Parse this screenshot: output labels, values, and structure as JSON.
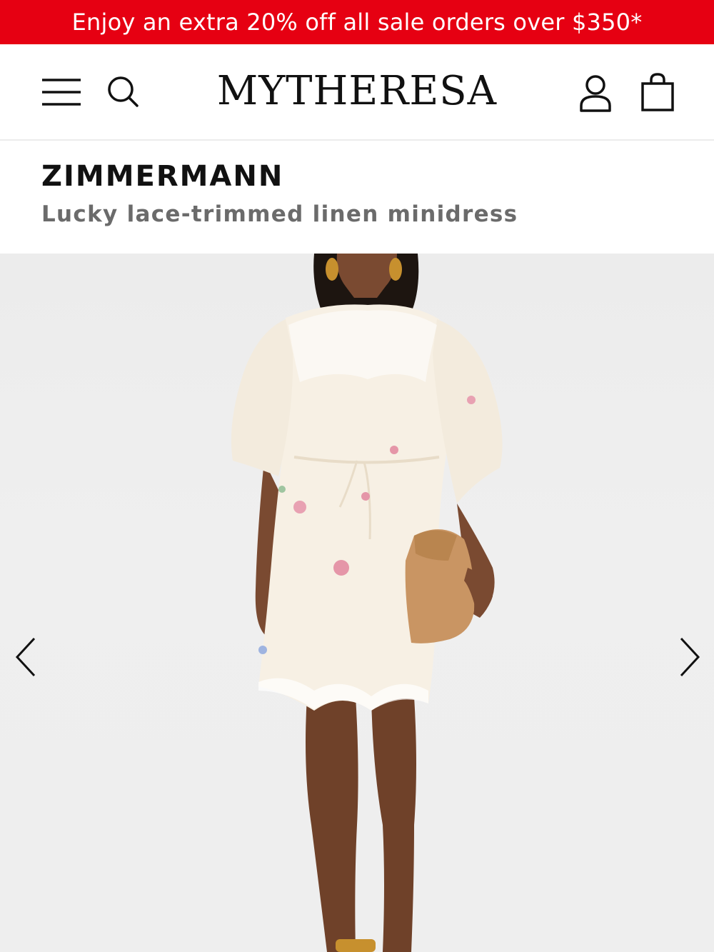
{
  "promo": {
    "text": "Enjoy an extra 20% off all sale orders over $350*",
    "background": "#e60012",
    "text_color": "#ffffff"
  },
  "header": {
    "logo": "MYTHERESA",
    "icons": {
      "menu": "hamburger-menu-icon",
      "search": "search-icon",
      "account": "user-icon",
      "bag": "shopping-bag-icon"
    }
  },
  "product": {
    "brand": "ZIMMERMANN",
    "name": "Lucky lace-trimmed linen minidress"
  },
  "gallery": {
    "image": "model-in-white-floral-lace-minidress-with-tan-clutch",
    "prev_icon": "chevron-left-icon",
    "next_icon": "chevron-right-icon"
  }
}
